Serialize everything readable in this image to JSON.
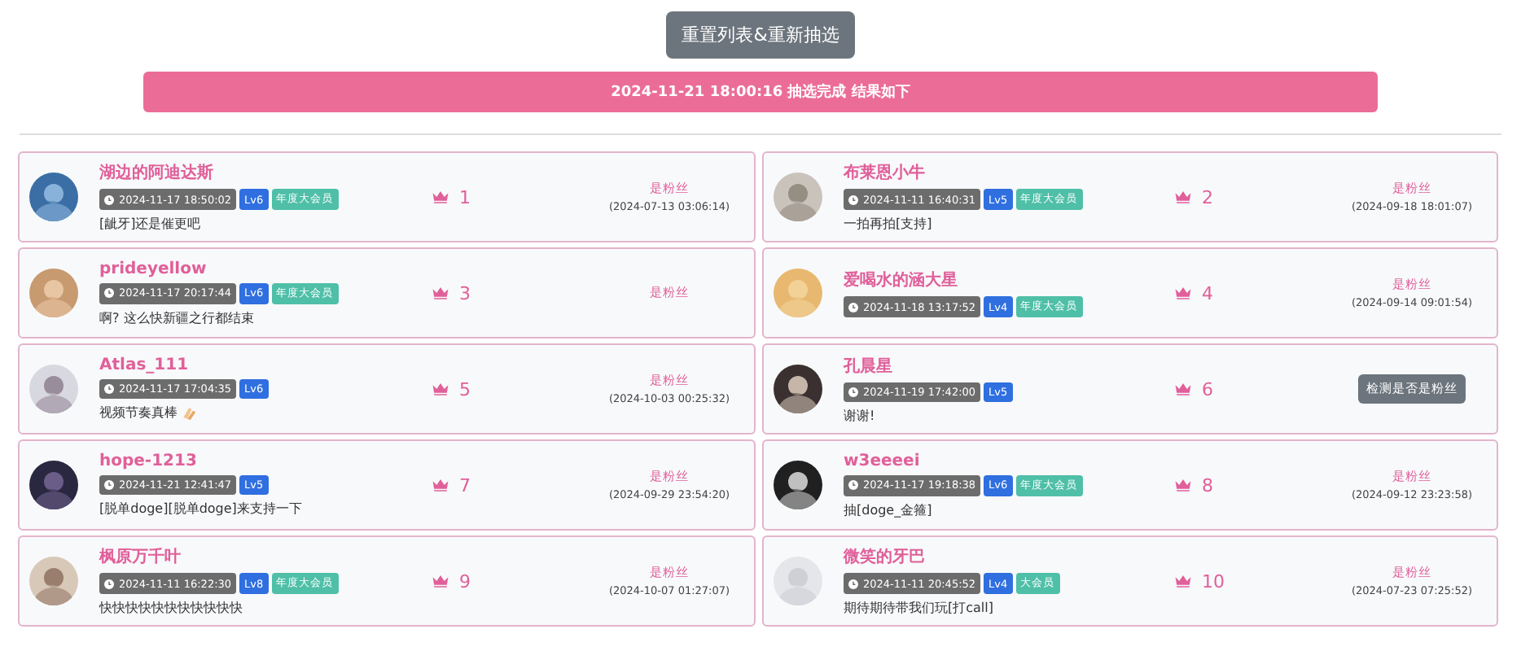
{
  "reset_button": "重置列表&重新抽选",
  "banner": "2024-11-21 18:00:16 抽选完成 结果如下",
  "winners": [
    {
      "name": "湖边的阿迪达斯",
      "time": "2024-11-17 18:50:02",
      "level": "Lv6",
      "vip": "年度大会员",
      "comment": "[龇牙]还是催更吧",
      "rank": "1",
      "fan": {
        "kind": "status",
        "label": "是粉丝",
        "since": "(2024-07-13 03:06:14)"
      }
    },
    {
      "name": "布莱恩小牛",
      "time": "2024-11-11 16:40:31",
      "level": "Lv5",
      "vip": "年度大会员",
      "comment": "一拍再拍[支持]",
      "rank": "2",
      "fan": {
        "kind": "status",
        "label": "是粉丝",
        "since": "(2024-09-18 18:01:07)"
      }
    },
    {
      "name": "prideyellow",
      "time": "2024-11-17 20:17:44",
      "level": "Lv6",
      "vip": "年度大会员",
      "comment": "啊? 这么快新疆之行都结束",
      "rank": "3",
      "fan": {
        "kind": "status",
        "label": "是粉丝"
      }
    },
    {
      "name": "爱喝水的涵大星",
      "time": "2024-11-18 13:17:52",
      "level": "Lv4",
      "vip": "年度大会员",
      "rank": "4",
      "fan": {
        "kind": "status",
        "label": "是粉丝",
        "since": "(2024-09-14 09:01:54)"
      }
    },
    {
      "name": "Atlas_111",
      "time": "2024-11-17 17:04:35",
      "level": "Lv6",
      "comment": "视频节奏真棒",
      "emoji": true,
      "rank": "5",
      "fan": {
        "kind": "status",
        "label": "是粉丝",
        "since": "(2024-10-03 00:25:32)"
      }
    },
    {
      "name": "孔晨星",
      "time": "2024-11-19 17:42:00",
      "level": "Lv5",
      "comment": "谢谢!",
      "rank": "6",
      "fan": {
        "kind": "check",
        "label": "检测是否是粉丝"
      }
    },
    {
      "name": "hope-1213",
      "time": "2024-11-21 12:41:47",
      "level": "Lv5",
      "comment": "[脱单doge][脱单doge]来支持一下",
      "rank": "7",
      "fan": {
        "kind": "status",
        "label": "是粉丝",
        "since": "(2024-09-29 23:54:20)"
      }
    },
    {
      "name": "w3eeeei",
      "time": "2024-11-17 19:18:38",
      "level": "Lv6",
      "vip": "年度大会员",
      "comment": "抽[doge_金箍]",
      "rank": "8",
      "fan": {
        "kind": "status",
        "label": "是粉丝",
        "since": "(2024-09-12 23:23:58)"
      }
    },
    {
      "name": "枫原万千叶",
      "time": "2024-11-11 16:22:30",
      "level": "Lv8",
      "vip": "年度大会员",
      "comment": "快快快快快快快快快快快",
      "rank": "9",
      "fan": {
        "kind": "status",
        "label": "是粉丝",
        "since": "(2024-10-07 01:27:07)"
      }
    },
    {
      "name": "微笑的牙巴",
      "time": "2024-11-11 20:45:52",
      "level": "Lv4",
      "vip": "大会员",
      "comment": "期待期待带我们玩[打call]",
      "rank": "10",
      "fan": {
        "kind": "status",
        "label": "是粉丝",
        "since": "(2024-07-23 07:25:52)"
      }
    }
  ]
}
